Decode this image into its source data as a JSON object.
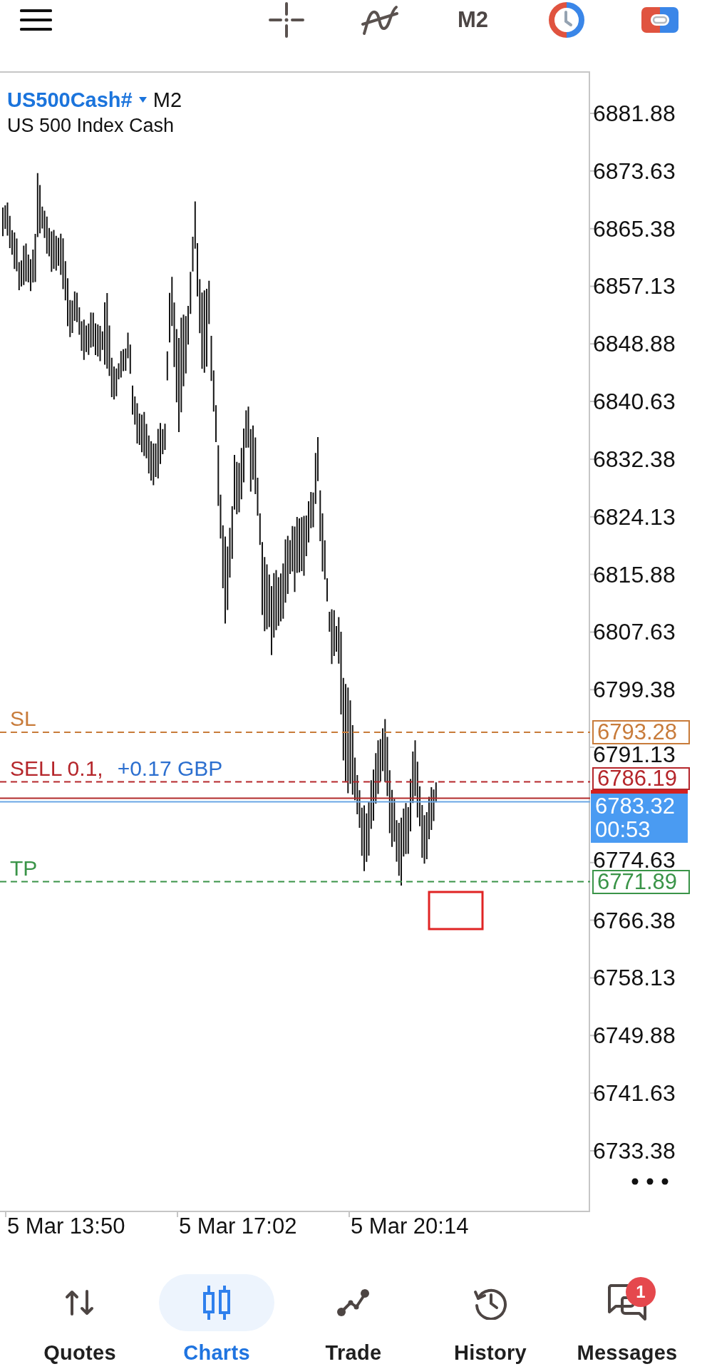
{
  "toolbar": {
    "timeframe": "M2"
  },
  "chart": {
    "symbol": "US500Cash#",
    "timeframe": "M2",
    "description": "US 500 Index Cash",
    "price_axis": [
      "6881.88",
      "6873.63",
      "6865.38",
      "6857.13",
      "6848.88",
      "6840.63",
      "6832.38",
      "6824.13",
      "6815.88",
      "6807.63",
      "6799.38",
      "6791.13",
      "6774.63",
      "6766.38",
      "6758.13",
      "6749.88",
      "6741.63",
      "6733.38"
    ],
    "time_axis": [
      "5 Mar 13:50",
      "5 Mar 17:02",
      "5 Mar 20:14"
    ],
    "levels": [
      {
        "label": "SL",
        "price": "6793.28",
        "color": "#c87b3a"
      },
      {
        "label": "SELL 0.1,",
        "profit": "+0.17 GBP",
        "price": "6786.19",
        "color": "#b5262b"
      },
      {
        "label": "TP",
        "price": "6771.89",
        "color": "#3a9448"
      }
    ],
    "current_price": {
      "price": "6783.32",
      "countdown": "00:53"
    }
  },
  "nav": [
    {
      "label": "Quotes",
      "selected": false
    },
    {
      "label": "Charts",
      "selected": true
    },
    {
      "label": "Trade",
      "selected": false
    },
    {
      "label": "History",
      "selected": false
    },
    {
      "label": "Messages",
      "selected": false,
      "badge": "1"
    }
  ]
}
